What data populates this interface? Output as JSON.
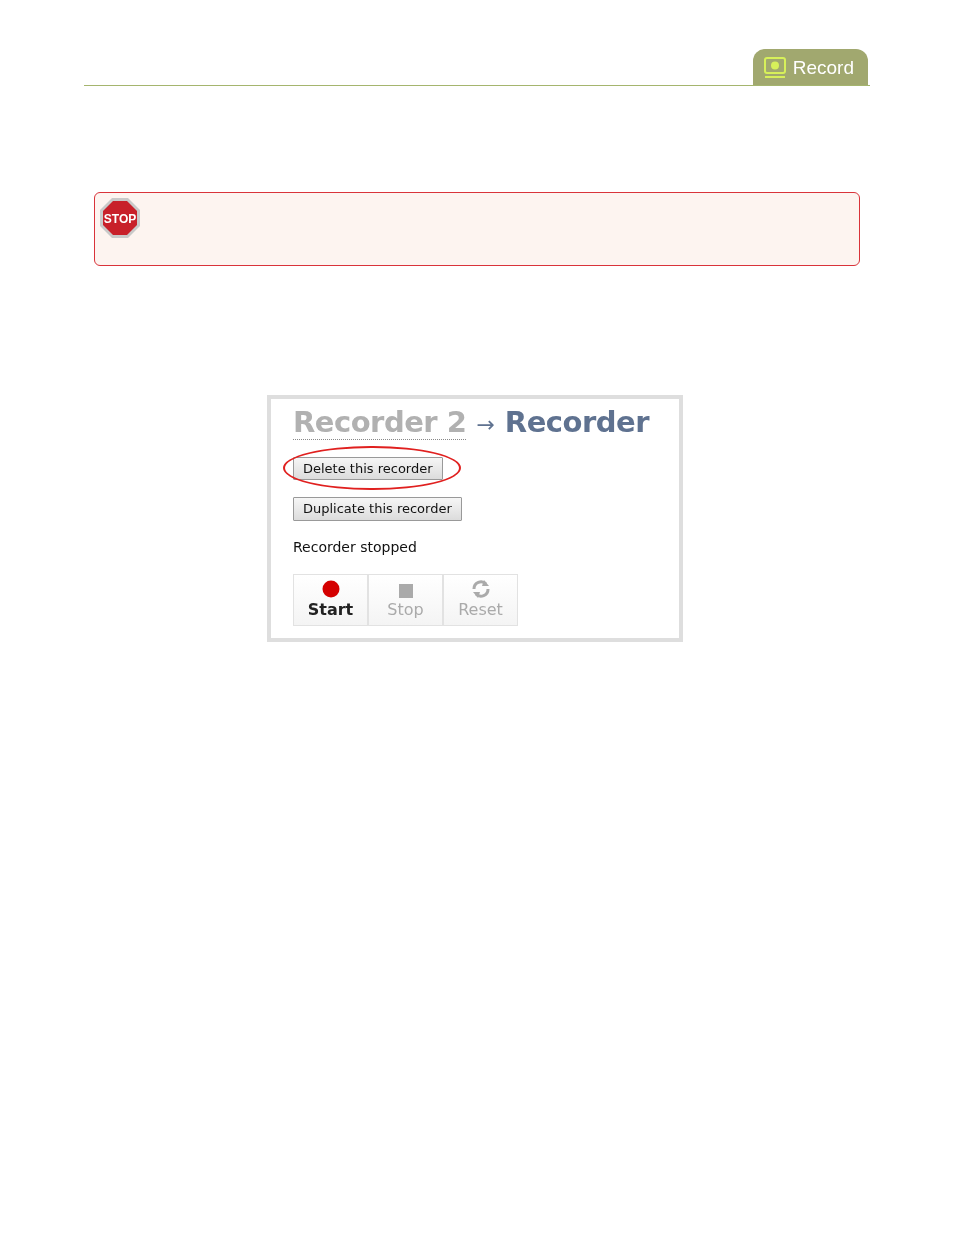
{
  "header_tab": {
    "label": "Record"
  },
  "warning": {
    "sign_text": "STOP"
  },
  "recorder": {
    "title": "Recorder 2",
    "arrow": "→",
    "subtitle": "Recorder",
    "actions": [
      {
        "label": "Delete this recorder",
        "highlighted": true
      },
      {
        "label": "Duplicate this recorder",
        "highlighted": false
      }
    ],
    "status": "Recorder stopped",
    "controls": [
      {
        "kind": "start",
        "label": "Start",
        "disabled": false
      },
      {
        "kind": "stop",
        "label": "Stop",
        "disabled": true
      },
      {
        "kind": "reset",
        "label": "Reset",
        "disabled": true
      }
    ]
  }
}
